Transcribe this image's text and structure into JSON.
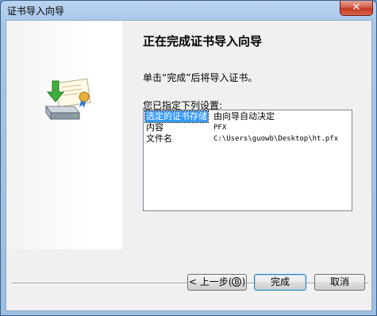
{
  "window": {
    "title": "证书导入向导",
    "close_glyph": "✕"
  },
  "main": {
    "heading": "正在完成证书导入向导",
    "hint": "单击“完成”后将导入证书。",
    "settings_label": "您已指定下列设置:",
    "settings": [
      {
        "key": "选定的证书存储",
        "value": "由向导自动决定",
        "mono": false,
        "selected": true
      },
      {
        "key": "内容",
        "value": "PFX",
        "mono": true,
        "selected": false
      },
      {
        "key": "文件名",
        "value": "C:\\Users\\guowb\\Desktop\\ht.pfx",
        "mono": true,
        "selected": false
      }
    ]
  },
  "buttons": {
    "back_label": "< 上一步",
    "back_accel": "B",
    "back_close": ")",
    "back_open": "(",
    "finish_label": "完成",
    "cancel_label": "取消"
  },
  "icons": {
    "wizard_graphic": "certificate-import-icon",
    "close": "close-icon"
  },
  "colors": {
    "selection": "#3399ff",
    "close_button": "#c2391f",
    "title_bar": "#a7c6e8"
  }
}
